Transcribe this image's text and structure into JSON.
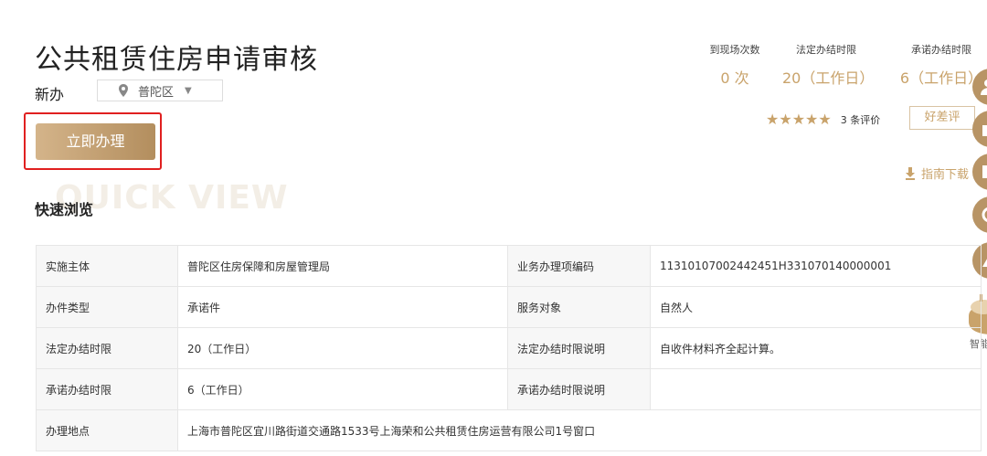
{
  "header": {
    "title": "公共租赁住房申请审核",
    "type_label": "新办",
    "district": "普陀区",
    "apply_button": "立即办理",
    "quick_view_bg": "QUICK VIEW",
    "quick_view_title": "快速浏览"
  },
  "stats": [
    {
      "label": "到现场次数",
      "value": "0 次"
    },
    {
      "label": "法定办结时限",
      "value": "20（工作日）"
    },
    {
      "label": "承诺办结时限",
      "value": "6（工作日）"
    }
  ],
  "rating": {
    "stars": "★★★★★",
    "star_count": 5,
    "count_text": "3 条评价",
    "review_button": "好差评"
  },
  "download_label": "指南下载",
  "side_panel": {
    "icons": [
      "user-icon",
      "bag-icon",
      "document-icon",
      "chat-icon",
      "location-icon"
    ],
    "assistant_label": "智能"
  },
  "table": {
    "rows": [
      {
        "k1": "实施主体",
        "v1": "普陀区住房保障和房屋管理局",
        "k2": "业务办理项编码",
        "v2": "11310107002442451H331070140000001"
      },
      {
        "k1": "办件类型",
        "v1": "承诺件",
        "k2": "服务对象",
        "v2": "自然人"
      },
      {
        "k1": "法定办结时限",
        "v1": "20（工作日）",
        "k2": "法定办结时限说明",
        "v2": "自收件材料齐全起计算。"
      },
      {
        "k1": "承诺办结时限",
        "v1": "6（工作日）",
        "k2": "承诺办结时限说明",
        "v2": ""
      },
      {
        "k1": "办理地点",
        "v1": "上海市普陀区宜川路街道交通路1533号上海荣和公共租赁住房运营有限公司1号窗口"
      }
    ]
  },
  "colors": {
    "accent": "#c9a36b",
    "button_gradient_start": "#d4b48a",
    "button_gradient_end": "#b38e5e",
    "highlight_border": "#e02020"
  }
}
